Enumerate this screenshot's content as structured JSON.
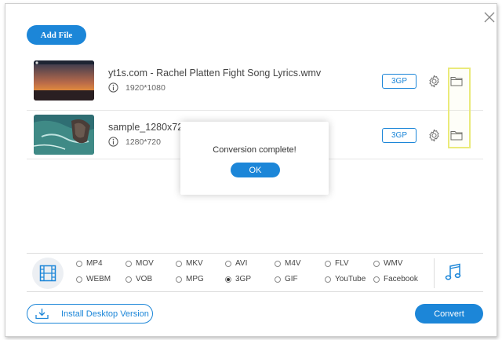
{
  "toolbar": {
    "add_file_label": "Add File"
  },
  "files": [
    {
      "name": "yt1s.com - Rachel Platten Fight Song Lyrics.wmv",
      "resolution": "1920*1080",
      "format": "3GP"
    },
    {
      "name": "sample_1280x720.",
      "resolution": "1280*720",
      "format": "3GP"
    }
  ],
  "dialog": {
    "message": "Conversion complete!",
    "ok_label": "OK"
  },
  "formats": {
    "options": [
      "MP4",
      "MOV",
      "MKV",
      "AVI",
      "M4V",
      "FLV",
      "WMV",
      "WEBM",
      "VOB",
      "MPG",
      "3GP",
      "GIF",
      "YouTube",
      "Facebook"
    ],
    "selected": "3GP"
  },
  "footer": {
    "install_label": "Install Desktop Version",
    "convert_label": "Convert"
  },
  "colors": {
    "accent": "#1c86d8",
    "highlight": "#eaea7a"
  }
}
